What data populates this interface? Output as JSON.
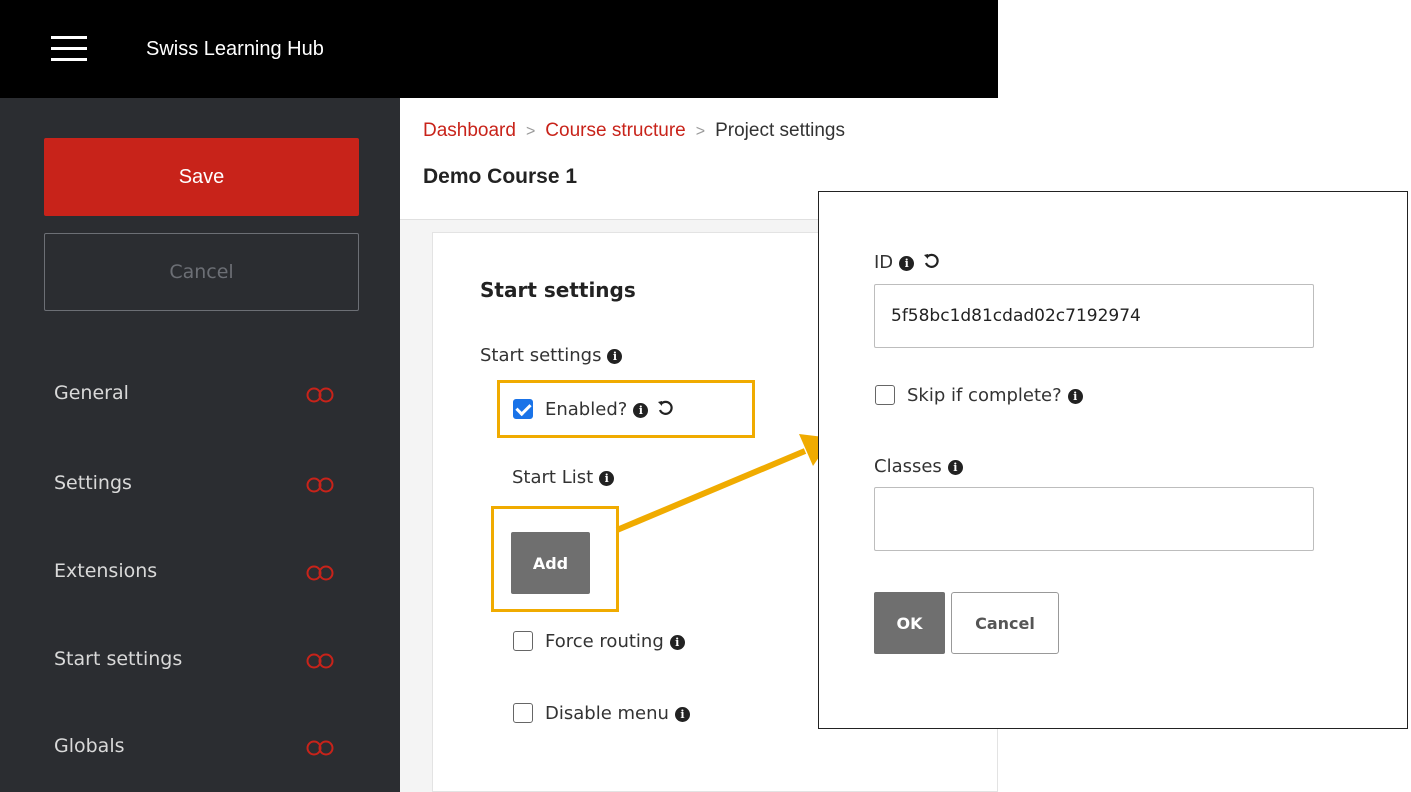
{
  "app": {
    "title": "Swiss Learning Hub"
  },
  "sidebar": {
    "save_label": "Save",
    "cancel_label": "Cancel",
    "items": [
      {
        "label": "General"
      },
      {
        "label": "Settings"
      },
      {
        "label": "Extensions"
      },
      {
        "label": "Start settings"
      },
      {
        "label": "Globals"
      }
    ],
    "toggle_color": "#c8231a"
  },
  "breadcrumb": {
    "items": [
      "Dashboard",
      "Course structure",
      "Project settings"
    ],
    "separator": ">"
  },
  "page": {
    "title": "Demo Course 1"
  },
  "start_settings": {
    "section_title": "Start settings",
    "group_label": "Start settings",
    "enabled_label": "Enabled?",
    "enabled_checked": true,
    "start_list_label": "Start List",
    "add_label": "Add",
    "force_routing_label": "Force routing",
    "force_routing_checked": false,
    "disable_menu_label": "Disable menu",
    "disable_menu_checked": false
  },
  "dialog": {
    "id_label": "ID",
    "id_value": "5f58bc1d81cdad02c7192974",
    "skip_label": "Skip if complete?",
    "skip_checked": false,
    "classes_label": "Classes",
    "classes_value": "",
    "ok_label": "OK",
    "cancel_label": "Cancel"
  },
  "highlight_color": "#f0ab00"
}
